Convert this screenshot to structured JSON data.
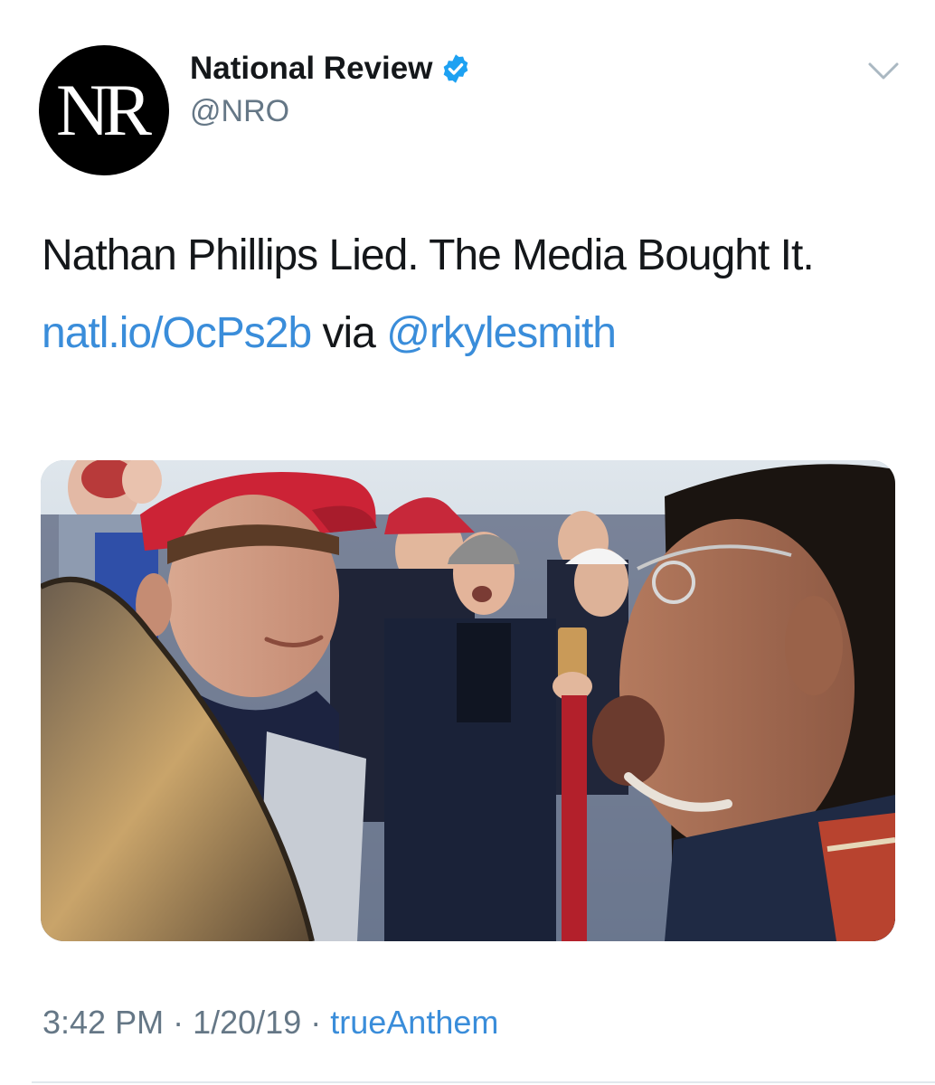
{
  "tweet": {
    "avatar_text": "NR",
    "display_name": "National Review",
    "handle": "@NRO",
    "text_plain": "Nathan Phillips Lied. The Media Bought It.",
    "link": "natl.io/OcPs2b",
    "via": "via",
    "mention": "@rkylesmith",
    "time": "3:42 PM",
    "separator": "·",
    "date": "1/20/19",
    "source": "trueAnthem"
  },
  "colors": {
    "link_blue": "#3a8dda",
    "verified_blue": "#1da1f2",
    "meta_gray": "#657786"
  },
  "icons": {
    "verified": "verified-badge-icon",
    "menu": "chevron-down-icon"
  }
}
